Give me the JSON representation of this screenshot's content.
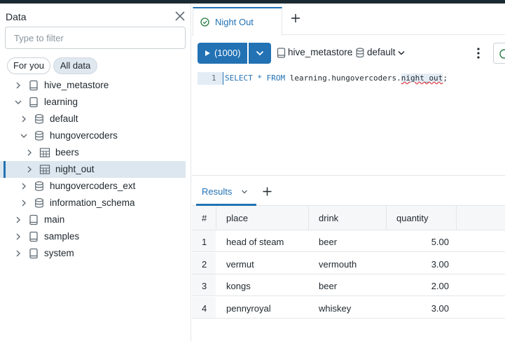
{
  "left_panel": {
    "title": "Data",
    "filter_placeholder": "Type to filter",
    "pills": {
      "for_you": "For you",
      "all_data": "All data"
    },
    "tree": [
      {
        "label": "hive_metastore",
        "icon": "catalog-icon",
        "level": 0,
        "expanded": false
      },
      {
        "label": "learning",
        "icon": "catalog-icon",
        "level": 0,
        "expanded": true
      },
      {
        "label": "default",
        "icon": "schema-icon",
        "level": 1,
        "expanded": false
      },
      {
        "label": "hungovercoders",
        "icon": "schema-icon",
        "level": 1,
        "expanded": true
      },
      {
        "label": "beers",
        "icon": "table-icon",
        "level": 2,
        "expanded": false
      },
      {
        "label": "night_out",
        "icon": "table-icon",
        "level": 2,
        "expanded": false,
        "selected": true
      },
      {
        "label": "hungovercoders_ext",
        "icon": "schema-icon",
        "level": 1,
        "expanded": false
      },
      {
        "label": "information_schema",
        "icon": "schema-icon",
        "level": 1,
        "expanded": false
      },
      {
        "label": "main",
        "icon": "catalog-icon",
        "level": 0,
        "expanded": false
      },
      {
        "label": "samples",
        "icon": "catalog-icon",
        "level": 0,
        "expanded": false
      },
      {
        "label": "system",
        "icon": "catalog-icon",
        "level": 0,
        "expanded": false
      }
    ]
  },
  "tabs": {
    "active_label": "Night Out"
  },
  "toolbar": {
    "run_label": "(1000)",
    "catalog": "hive_metastore",
    "separator": ".",
    "schema": "default"
  },
  "editor": {
    "line_number": "1",
    "select_kw": "SELECT",
    "star": "*",
    "from_kw": "FROM",
    "table_prefix": "learning.hungovercoders.",
    "table_hl": "night_out",
    "terminator": ";"
  },
  "results": {
    "tab_label": "Results",
    "columns": [
      "#",
      "place",
      "drink",
      "quantity"
    ],
    "rows": [
      [
        "1",
        "head of steam",
        "beer",
        "5.00"
      ],
      [
        "2",
        "vermut",
        "vermouth",
        "3.00"
      ],
      [
        "3",
        "kongs",
        "beer",
        "2.00"
      ],
      [
        "4",
        "pennyroyal",
        "whiskey",
        "3.00"
      ]
    ]
  },
  "colors": {
    "accent": "#2272b4",
    "selected_row": "#dde7ef",
    "success": "#277c43"
  }
}
